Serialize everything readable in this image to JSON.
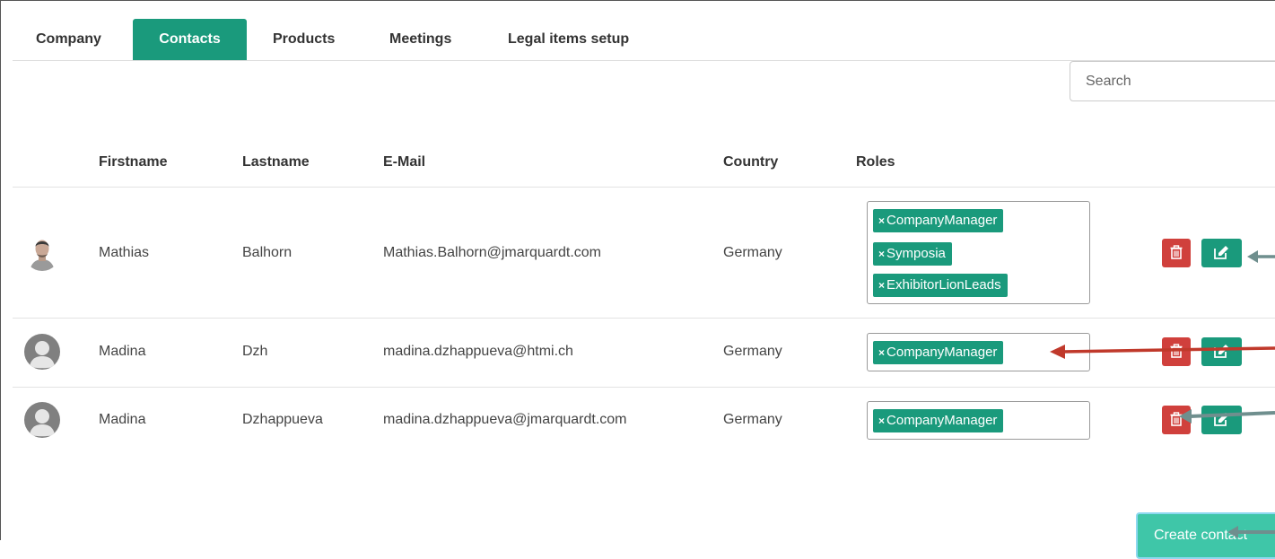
{
  "tabs": [
    {
      "label": "Company"
    },
    {
      "label": "Contacts"
    },
    {
      "label": "Products"
    },
    {
      "label": "Meetings"
    },
    {
      "label": "Legal items setup"
    }
  ],
  "active_tab": "Contacts",
  "search": {
    "placeholder": "Search"
  },
  "table": {
    "headers": {
      "firstname": "Firstname",
      "lastname": "Lastname",
      "email": "E-Mail",
      "country": "Country",
      "roles": "Roles"
    },
    "rows": [
      {
        "firstname": "Mathias",
        "lastname": "Balhorn",
        "email": "Mathias.Balhorn@jmarquardt.com",
        "country": "Germany",
        "avatar": "photo",
        "roles": [
          "CompanyManager",
          "Symposia",
          "ExhibitorLionLeads"
        ]
      },
      {
        "firstname": "Madina",
        "lastname": "Dzh",
        "email": "madina.dzhappueva@htmi.ch",
        "country": "Germany",
        "avatar": "generic-user-icon",
        "roles": [
          "CompanyManager"
        ]
      },
      {
        "firstname": "Madina",
        "lastname": "Dzhappueva",
        "email": "madina.dzhappueva@jmarquardt.com",
        "country": "Germany",
        "avatar": "generic-user-icon",
        "roles": [
          "CompanyManager"
        ]
      }
    ]
  },
  "tag_remove_symbol": "×",
  "actions": {
    "create_label": "Create contact"
  },
  "colors": {
    "accent": "#1a9a7c",
    "delete": "#d0403c",
    "create": "#3fc6a8",
    "annotation_red": "#c0392b",
    "annotation_gray": "#6f8f8e"
  }
}
